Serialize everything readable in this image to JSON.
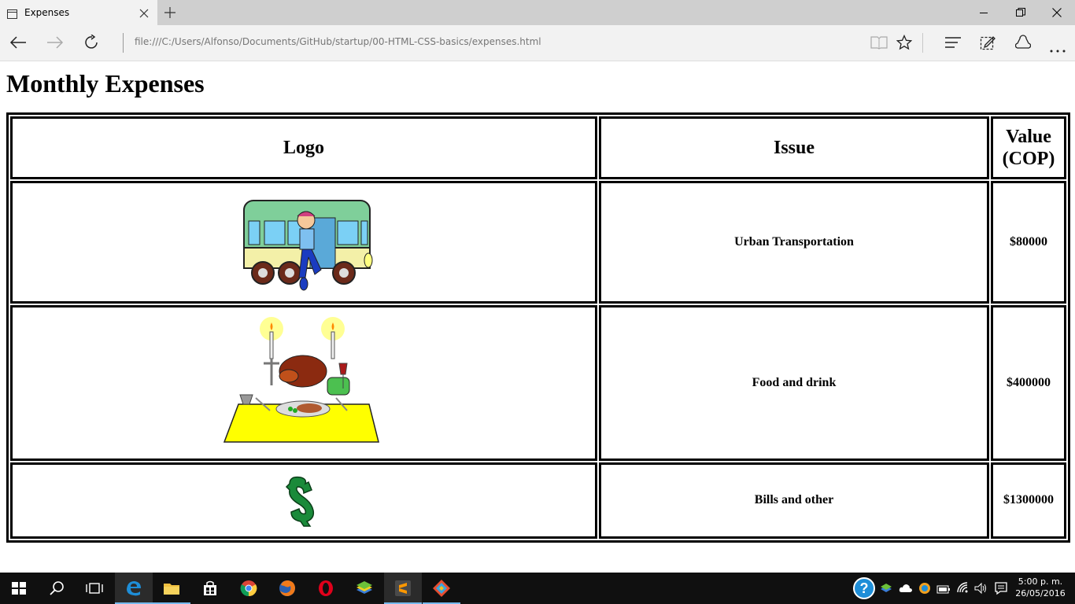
{
  "browser": {
    "tab_title": "Expenses",
    "address": "file:///C:/Users/Alfonso/Documents/GitHub/startup/00-HTML-CSS-basics/expenses.html"
  },
  "page": {
    "title": "Monthly Expenses",
    "table": {
      "headers": [
        "Logo",
        "Issue",
        "Value (COP)"
      ],
      "rows": [
        {
          "logo": "bus-illustration",
          "issue": "Urban Transportation",
          "value": "$80000"
        },
        {
          "logo": "dinner-table-illustration",
          "issue": "Food and drink",
          "value": "$400000"
        },
        {
          "logo": "dollar-sign-illustration",
          "issue": "Bills and other",
          "value": "$1300000"
        }
      ]
    }
  },
  "taskbar": {
    "time": "5:00 p. m.",
    "date": "26/05/2016"
  }
}
